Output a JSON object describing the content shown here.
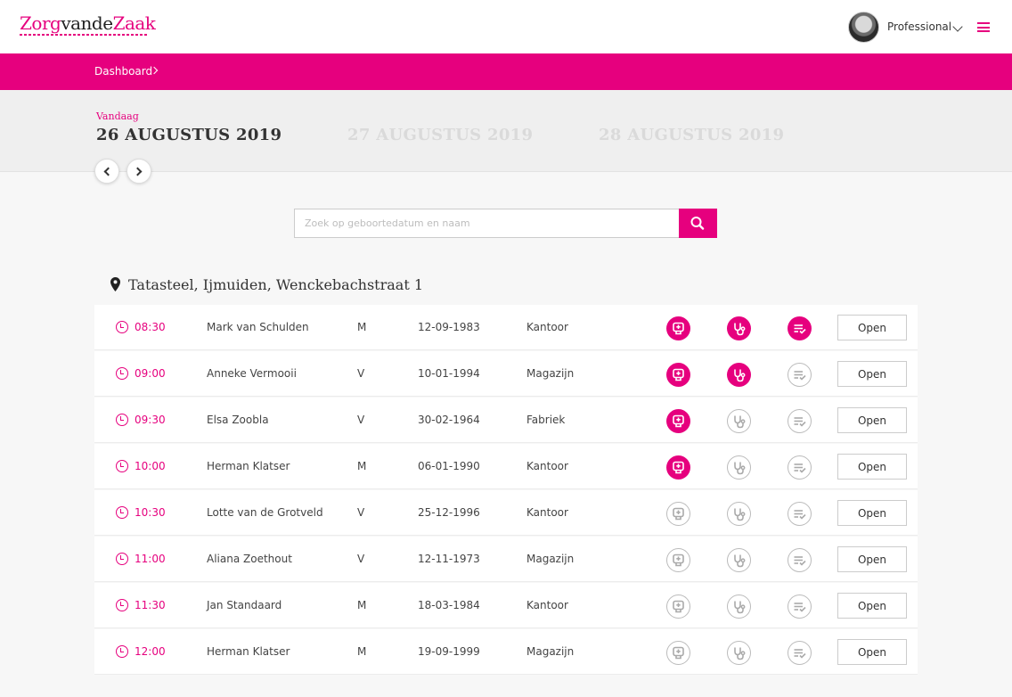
{
  "header": {
    "logo_part1": "Zorg",
    "logo_part2": "van",
    "logo_part3": "de",
    "logo_part4": "Zaak",
    "user_label": "Professional"
  },
  "breadcrumb": {
    "label": "Dashboard"
  },
  "dates": {
    "today_label": "Vandaag",
    "active": "26 AUGUSTUS 2019",
    "next": "27 AUGUSTUS 2019",
    "next2": "28 AUGUSTUS 2019"
  },
  "search": {
    "placeholder": "Zoek op geboortedatum en naam",
    "value": ""
  },
  "location": {
    "label": "Tatasteel, Ijmuiden, Wenckebachstraat 1"
  },
  "colors": {
    "accent": "#e6007e",
    "background": "#f7f7f7"
  },
  "appointments": [
    {
      "time": "08:30",
      "name": "Mark van Schulden",
      "gender": "M",
      "dob": "12-09-1983",
      "dept": "Kantoor",
      "status": [
        true,
        true,
        true
      ],
      "action": "Open"
    },
    {
      "time": "09:00",
      "name": "Anneke Vermooii",
      "gender": "V",
      "dob": "10-01-1994",
      "dept": "Magazijn",
      "status": [
        true,
        true,
        false
      ],
      "action": "Open"
    },
    {
      "time": "09:30",
      "name": "Elsa Zoobla",
      "gender": "V",
      "dob": "30-02-1964",
      "dept": "Fabriek",
      "status": [
        true,
        false,
        false
      ],
      "action": "Open"
    },
    {
      "time": "10:00",
      "name": "Herman Klatser",
      "gender": "M",
      "dob": "06-01-1990",
      "dept": "Kantoor",
      "status": [
        true,
        false,
        false
      ],
      "action": "Open"
    },
    {
      "time": "10:30",
      "name": "Lotte van de Grotveld",
      "gender": "V",
      "dob": "25-12-1996",
      "dept": "Kantoor",
      "status": [
        false,
        false,
        false
      ],
      "action": "Open"
    },
    {
      "time": "11:00",
      "name": "Aliana Zoethout",
      "gender": "V",
      "dob": "12-11-1973",
      "dept": "Magazijn",
      "status": [
        false,
        false,
        false
      ],
      "action": "Open"
    },
    {
      "time": "11:30",
      "name": "Jan Standaard",
      "gender": "M",
      "dob": "18-03-1984",
      "dept": "Kantoor",
      "status": [
        false,
        false,
        false
      ],
      "action": "Open"
    },
    {
      "time": "12:00",
      "name": "Herman Klatser",
      "gender": "M",
      "dob": "19-09-1999",
      "dept": "Magazijn",
      "status": [
        false,
        false,
        false
      ],
      "action": "Open"
    }
  ]
}
